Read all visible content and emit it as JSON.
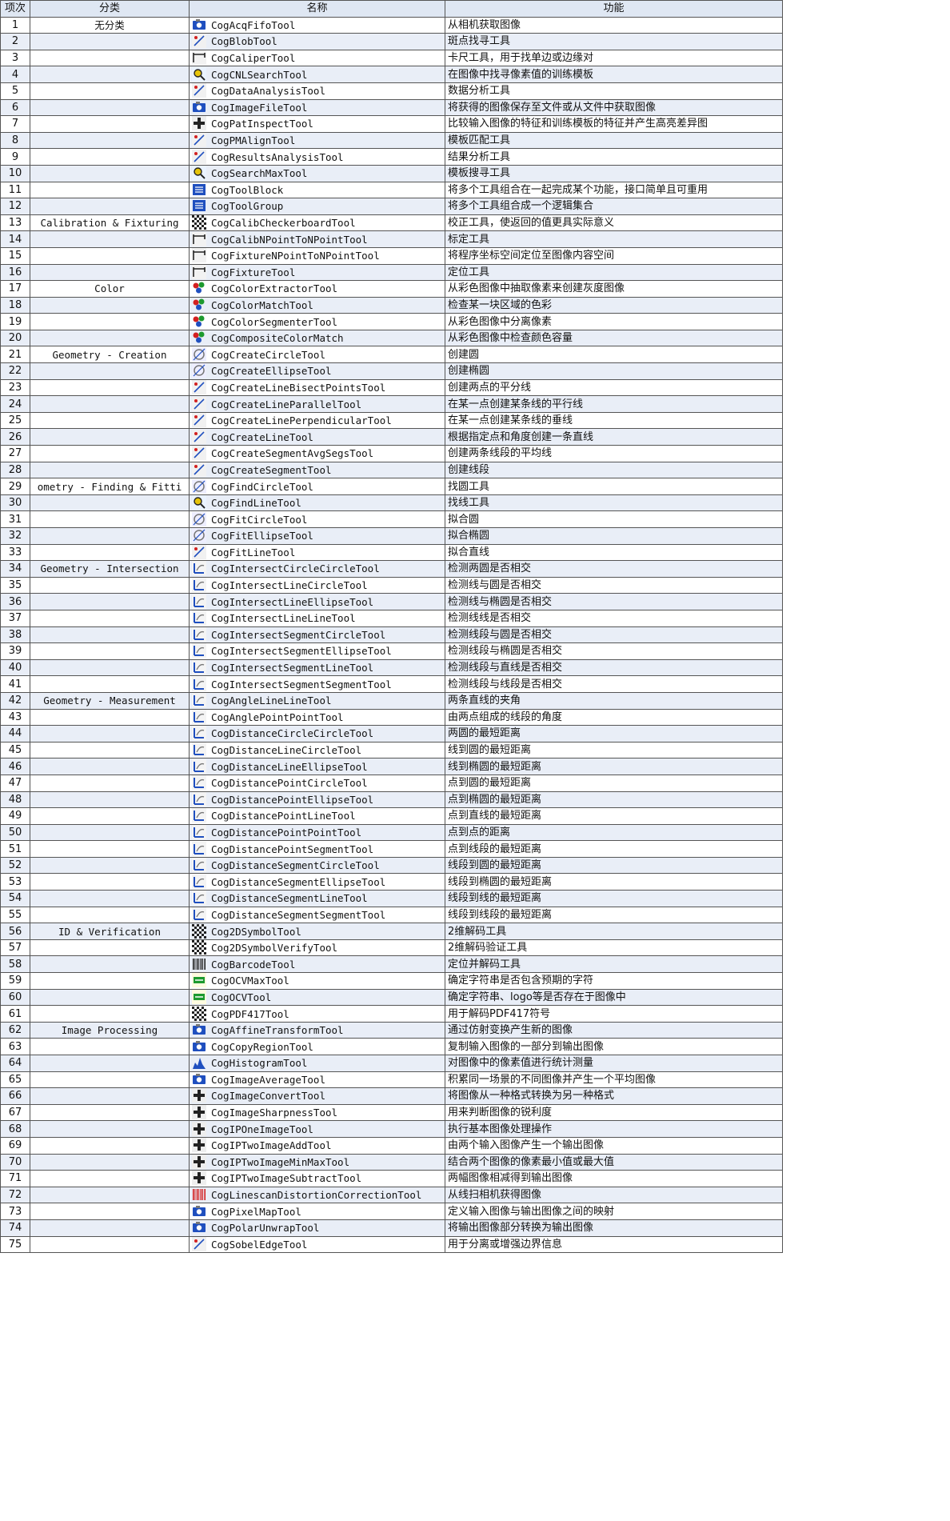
{
  "headers": [
    "项次",
    "分类",
    "名称",
    "功能"
  ],
  "rows": [
    {
      "n": "1",
      "cat": "无分类",
      "name": "CogAcqFifoTool",
      "func": "从相机获取图像",
      "icon": "camera-icon"
    },
    {
      "n": "2",
      "cat": "",
      "name": "CogBlobTool",
      "func": "斑点找寻工具",
      "icon": "blob-icon"
    },
    {
      "n": "3",
      "cat": "",
      "name": "CogCaliperTool",
      "func": "卡尺工具，用于找单边或边缘对",
      "icon": "caliper-icon"
    },
    {
      "n": "4",
      "cat": "",
      "name": "CogCNLSearchTool",
      "func": "在图像中找寻像素值的训练模板",
      "icon": "search-icon"
    },
    {
      "n": "5",
      "cat": "",
      "name": "CogDataAnalysisTool",
      "func": "数据分析工具",
      "icon": "data-analysis-icon"
    },
    {
      "n": "6",
      "cat": "",
      "name": "CogImageFileTool",
      "func": "将获得的图像保存至文件或从文件中获取图像",
      "icon": "image-file-icon"
    },
    {
      "n": "7",
      "cat": "",
      "name": "CogPatInspectTool",
      "func": "比较输入图像的特征和训练模板的特征并产生高亮差异图",
      "icon": "pat-inspect-icon"
    },
    {
      "n": "8",
      "cat": "",
      "name": "CogPMAlignTool",
      "func": "模板匹配工具",
      "icon": "pm-align-icon"
    },
    {
      "n": "9",
      "cat": "",
      "name": "CogResultsAnalysisTool",
      "func": "结果分析工具",
      "icon": "results-analysis-icon"
    },
    {
      "n": "10",
      "cat": "",
      "name": "CogSearchMaxTool",
      "func": "模板搜寻工具",
      "icon": "search-max-icon"
    },
    {
      "n": "11",
      "cat": "",
      "name": "CogToolBlock",
      "func": "将多个工具组合在一起完成某个功能，接口简单且可重用",
      "icon": "tool-block-icon"
    },
    {
      "n": "12",
      "cat": "",
      "name": "CogToolGroup",
      "func": "将多个工具组合成一个逻辑集合",
      "icon": "tool-group-icon"
    },
    {
      "n": "13",
      "cat": "Calibration & Fixturing",
      "name": "CogCalibCheckerboardTool",
      "func": "校正工具，使返回的值更具实际意义",
      "icon": "checkerboard-icon"
    },
    {
      "n": "14",
      "cat": "",
      "name": "CogCalibNPointToNPointTool",
      "func": "标定工具",
      "icon": "calib-npoint-icon"
    },
    {
      "n": "15",
      "cat": "",
      "name": "CogFixtureNPointToNPointTool",
      "func": "将程序坐标空间定位至图像内容空间",
      "icon": "fixture-npoint-icon"
    },
    {
      "n": "16",
      "cat": "",
      "name": "CogFixtureTool",
      "func": "定位工具",
      "icon": "fixture-icon"
    },
    {
      "n": "17",
      "cat": "Color",
      "name": "CogColorExtractorTool",
      "func": "从彩色图像中抽取像素来创建灰度图像",
      "icon": "color-extractor-icon"
    },
    {
      "n": "18",
      "cat": "",
      "name": "CogColorMatchTool",
      "func": "检查某一块区域的色彩",
      "icon": "color-match-icon"
    },
    {
      "n": "19",
      "cat": "",
      "name": "CogColorSegmenterTool",
      "func": "从彩色图像中分离像素",
      "icon": "color-segmenter-icon"
    },
    {
      "n": "20",
      "cat": "",
      "name": "CogCompositeColorMatch",
      "func": "从彩色图像中检查颜色容量",
      "icon": "composite-color-icon"
    },
    {
      "n": "21",
      "cat": "Geometry - Creation",
      "name": "CogCreateCircleTool",
      "func": "创建圆",
      "icon": "create-circle-icon"
    },
    {
      "n": "22",
      "cat": "",
      "name": "CogCreateEllipseTool",
      "func": "创建椭圆",
      "icon": "create-ellipse-icon"
    },
    {
      "n": "23",
      "cat": "",
      "name": "CogCreateLineBisectPointsTool",
      "func": "创建两点的平分线",
      "icon": "line-bisect-icon"
    },
    {
      "n": "24",
      "cat": "",
      "name": "CogCreateLineParallelTool",
      "func": "在某一点创建某条线的平行线",
      "icon": "line-parallel-icon"
    },
    {
      "n": "25",
      "cat": "",
      "name": "CogCreateLinePerpendicularTool",
      "func": "在某一点创建某条线的垂线",
      "icon": "line-perpendicular-icon"
    },
    {
      "n": "26",
      "cat": "",
      "name": "CogCreateLineTool",
      "func": "根据指定点和角度创建一条直线",
      "icon": "create-line-icon"
    },
    {
      "n": "27",
      "cat": "",
      "name": "CogCreateSegmentAvgSegsTool",
      "func": "创建两条线段的平均线",
      "icon": "segment-avg-icon"
    },
    {
      "n": "28",
      "cat": "",
      "name": "CogCreateSegmentTool",
      "func": "创建线段",
      "icon": "create-segment-icon"
    },
    {
      "n": "29",
      "cat": "ometry - Finding & Fitti",
      "name": "CogFindCircleTool",
      "func": "找圆工具",
      "icon": "find-circle-icon"
    },
    {
      "n": "30",
      "cat": "",
      "name": "CogFindLineTool",
      "func": "找线工具",
      "icon": "find-line-icon"
    },
    {
      "n": "31",
      "cat": "",
      "name": "CogFitCircleTool",
      "func": "拟合圆",
      "icon": "fit-circle-icon"
    },
    {
      "n": "32",
      "cat": "",
      "name": "CogFitEllipseTool",
      "func": "拟合椭圆",
      "icon": "fit-ellipse-icon"
    },
    {
      "n": "33",
      "cat": "",
      "name": "CogFitLineTool",
      "func": "拟合直线",
      "icon": "fit-line-icon"
    },
    {
      "n": "34",
      "cat": "Geometry - Intersection",
      "name": "CogIntersectCircleCircleTool",
      "func": "检测两圆是否相交",
      "icon": "intersect-icon"
    },
    {
      "n": "35",
      "cat": "",
      "name": "CogIntersectLineCircleTool",
      "func": "检测线与圆是否相交",
      "icon": "intersect-icon"
    },
    {
      "n": "36",
      "cat": "",
      "name": "CogIntersectLineEllipseTool",
      "func": "检测线与椭圆是否相交",
      "icon": "intersect-icon"
    },
    {
      "n": "37",
      "cat": "",
      "name": "CogIntersectLineLineTool",
      "func": "检测线线是否相交",
      "icon": "intersect-icon"
    },
    {
      "n": "38",
      "cat": "",
      "name": "CogIntersectSegmentCircleTool",
      "func": "检测线段与圆是否相交",
      "icon": "intersect-icon"
    },
    {
      "n": "39",
      "cat": "",
      "name": "CogIntersectSegmentEllipseTool",
      "func": "检测线段与椭圆是否相交",
      "icon": "intersect-icon"
    },
    {
      "n": "40",
      "cat": "",
      "name": "CogIntersectSegmentLineTool",
      "func": "检测线段与直线是否相交",
      "icon": "intersect-icon"
    },
    {
      "n": "41",
      "cat": "",
      "name": "CogIntersectSegmentSegmentTool",
      "func": "检测线段与线段是否相交",
      "icon": "intersect-icon"
    },
    {
      "n": "42",
      "cat": "Geometry - Measurement",
      "name": "CogAngleLineLineTool",
      "func": "两条直线的夹角",
      "icon": "angle-icon"
    },
    {
      "n": "43",
      "cat": "",
      "name": "CogAnglePointPointTool",
      "func": "由两点组成的线段的角度",
      "icon": "angle-point-icon"
    },
    {
      "n": "44",
      "cat": "",
      "name": "CogDistanceCircleCircleTool",
      "func": "两圆的最短距离",
      "icon": "distance-icon"
    },
    {
      "n": "45",
      "cat": "",
      "name": "CogDistanceLineCircleTool",
      "func": "线到圆的最短距离",
      "icon": "distance-icon"
    },
    {
      "n": "46",
      "cat": "",
      "name": "CogDistanceLineEllipseTool",
      "func": "线到椭圆的最短距离",
      "icon": "distance-icon"
    },
    {
      "n": "47",
      "cat": "",
      "name": "CogDistancePointCircleTool",
      "func": "点到圆的最短距离",
      "icon": "distance-icon"
    },
    {
      "n": "48",
      "cat": "",
      "name": "CogDistancePointEllipseTool",
      "func": "点到椭圆的最短距离",
      "icon": "distance-icon"
    },
    {
      "n": "49",
      "cat": "",
      "name": "CogDistancePointLineTool",
      "func": "点到直线的最短距离",
      "icon": "distance-icon"
    },
    {
      "n": "50",
      "cat": "",
      "name": "CogDistancePointPointTool",
      "func": "点到点的距离",
      "icon": "distance-icon"
    },
    {
      "n": "51",
      "cat": "",
      "name": "CogDistancePointSegmentTool",
      "func": "点到线段的最短距离",
      "icon": "distance-icon"
    },
    {
      "n": "52",
      "cat": "",
      "name": "CogDistanceSegmentCircleTool",
      "func": "线段到圆的最短距离",
      "icon": "distance-icon"
    },
    {
      "n": "53",
      "cat": "",
      "name": "CogDistanceSegmentEllipseTool",
      "func": "线段到椭圆的最短距离",
      "icon": "distance-icon"
    },
    {
      "n": "54",
      "cat": "",
      "name": "CogDistanceSegmentLineTool",
      "func": "线段到线的最短距离",
      "icon": "distance-icon"
    },
    {
      "n": "55",
      "cat": "",
      "name": "CogDistanceSegmentSegmentTool",
      "func": "线段到线段的最短距离",
      "icon": "distance-icon"
    },
    {
      "n": "56",
      "cat": "ID & Verification",
      "name": "Cog2DSymbolTool",
      "func": "2维解码工具",
      "icon": "symbol-2d-icon"
    },
    {
      "n": "57",
      "cat": "",
      "name": "Cog2DSymbolVerifyTool",
      "func": "2维解码验证工具",
      "icon": "symbol-verify-icon"
    },
    {
      "n": "58",
      "cat": "",
      "name": "CogBarcodeTool",
      "func": "定位并解码工具",
      "icon": "barcode-icon"
    },
    {
      "n": "59",
      "cat": "",
      "name": "CogOCVMaxTool",
      "func": "确定字符串是否包含预期的字符",
      "icon": "ocv-max-icon"
    },
    {
      "n": "60",
      "cat": "",
      "name": "CogOCVTool",
      "func": "确定字符串、logo等是否存在于图像中",
      "icon": "ocv-icon"
    },
    {
      "n": "61",
      "cat": "",
      "name": "CogPDF417Tool",
      "func": "用于解码PDF417符号",
      "icon": "pdf417-icon"
    },
    {
      "n": "62",
      "cat": "Image Processing",
      "name": "CogAffineTransformTool",
      "func": "通过仿射变换产生新的图像",
      "icon": "affine-icon"
    },
    {
      "n": "63",
      "cat": "",
      "name": "CogCopyRegionTool",
      "func": "复制输入图像的一部分到输出图像",
      "icon": "copy-region-icon"
    },
    {
      "n": "64",
      "cat": "",
      "name": "CogHistogramTool",
      "func": "对图像中的像素值进行统计测量",
      "icon": "histogram-icon"
    },
    {
      "n": "65",
      "cat": "",
      "name": "CogImageAverageTool",
      "func": "积累同一场景的不同图像并产生一个平均图像",
      "icon": "image-average-icon"
    },
    {
      "n": "66",
      "cat": "",
      "name": "CogImageConvertTool",
      "func": "将图像从一种格式转换为另一种格式",
      "icon": "image-convert-icon"
    },
    {
      "n": "67",
      "cat": "",
      "name": "CogImageSharpnessTool",
      "func": "用来判断图像的锐利度",
      "icon": "sharpness-icon"
    },
    {
      "n": "68",
      "cat": "",
      "name": "CogIPOneImageTool",
      "func": "执行基本图像处理操作",
      "icon": "ip-one-icon"
    },
    {
      "n": "69",
      "cat": "",
      "name": "CogIPTwoImageAddTool",
      "func": "由两个输入图像产生一个输出图像",
      "icon": "ip-two-icon"
    },
    {
      "n": "70",
      "cat": "",
      "name": "CogIPTwoImageMinMaxTool",
      "func": "结合两个图像的像素最小值或最大值",
      "icon": "ip-two-icon"
    },
    {
      "n": "71",
      "cat": "",
      "name": "CogIPTwoImageSubtractTool",
      "func": "两幅图像相减得到输出图像",
      "icon": "ip-two-icon"
    },
    {
      "n": "72",
      "cat": "",
      "name": "CogLinescanDistortionCorrectionTool",
      "func": "从线扫相机获得图像",
      "icon": "linescan-icon"
    },
    {
      "n": "73",
      "cat": "",
      "name": "CogPixelMapTool",
      "func": "定义输入图像与输出图像之间的映射",
      "icon": "pixel-map-icon"
    },
    {
      "n": "74",
      "cat": "",
      "name": "CogPolarUnwrapTool",
      "func": "将输出图像部分转换为输出图像",
      "icon": "polar-unwrap-icon"
    },
    {
      "n": "75",
      "cat": "",
      "name": "CogSobelEdgeTool",
      "func": "用于分离或增强边界信息",
      "icon": "sobel-edge-icon"
    }
  ]
}
